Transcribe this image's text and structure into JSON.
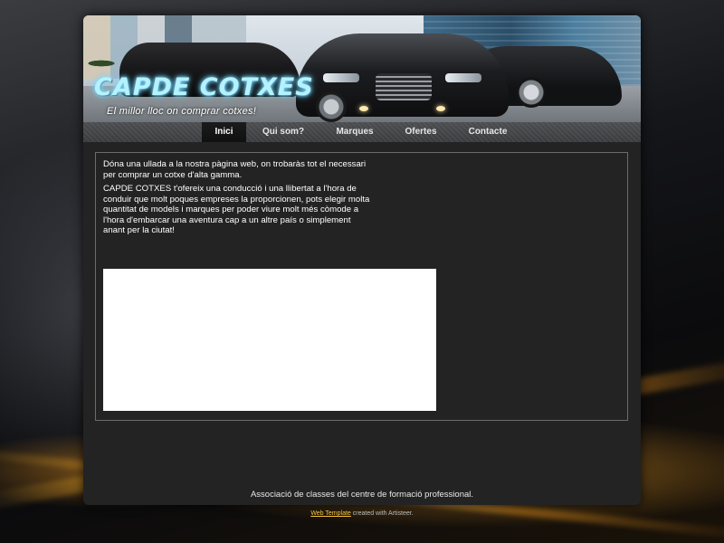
{
  "header": {
    "logo_text": "CAPDE COTXES",
    "slogan": "El millor lloc on comprar cotxes!"
  },
  "nav": {
    "items": [
      {
        "label": "Inici",
        "active": true
      },
      {
        "label": "Qui som?",
        "active": false
      },
      {
        "label": "Marques",
        "active": false
      },
      {
        "label": "Ofertes",
        "active": false
      },
      {
        "label": "Contacte",
        "active": false
      }
    ]
  },
  "content": {
    "paragraph_1": "Dóna una ullada a la nostra pàgina web, on trobaràs tot el necessari per comprar un cotxe d'alta gamma.",
    "paragraph_2": "CAPDE COTXES t'ofereix una conducció i una llibertat a l'hora de conduir que molt poques empreses la proporcionen, pots elegir molta quantitat de models i marques per poder viure molt més còmode a l'hora d'embarcar una aventura cap a un altre país o simplement anant per la ciutat!"
  },
  "footer": {
    "text": "Associació de classes del centre de formació professional."
  },
  "credit": {
    "link_text": "Web Template",
    "suffix": " created with Artisteer."
  },
  "colors": {
    "logo": "#b5f2ff",
    "credit_link": "#f5c341",
    "panel_bg": "#232323"
  }
}
